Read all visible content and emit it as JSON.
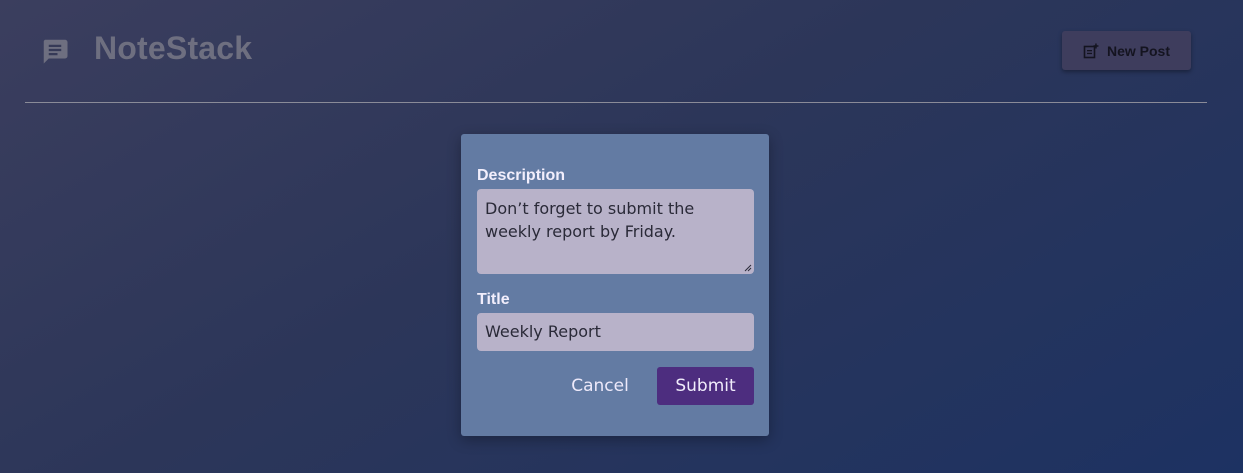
{
  "app": {
    "title": "NoteStack",
    "logo_icon": "chat-bubble-icon"
  },
  "toolbar": {
    "new_post_label": "New Post",
    "new_post_icon": "new-post-icon"
  },
  "dialog": {
    "description_label": "Description",
    "description_value": "Don’t forget to submit the weekly report by Friday.",
    "title_label": "Title",
    "title_value": "Weekly Report",
    "cancel_label": "Cancel",
    "submit_label": "Submit"
  },
  "colors": {
    "accent": "#4d2d7f",
    "dialog_bg": "#637ba3",
    "field_bg": "#b8b2c9"
  }
}
